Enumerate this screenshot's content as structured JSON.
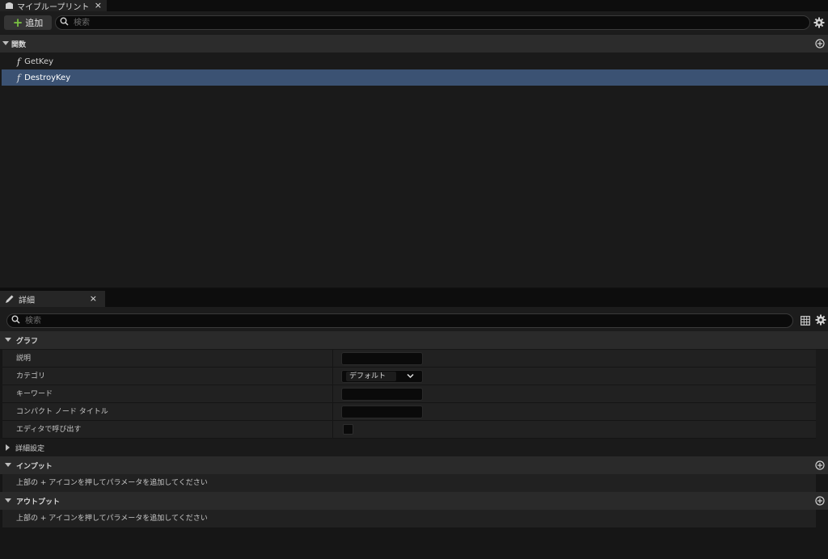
{
  "blueprint": {
    "tab_title": "マイブループリント",
    "tab_close": "×",
    "add_label": "追加",
    "search_placeholder": "検索",
    "functions_header": "関数",
    "functions": [
      {
        "label": "GetKey",
        "selected": false
      },
      {
        "label": "DestroyKey",
        "selected": true
      }
    ],
    "function_glyph": "f"
  },
  "details": {
    "tab_title": "詳細",
    "tab_close": "×",
    "search_placeholder": "検索",
    "graph_header": "グラフ",
    "properties": {
      "description_label": "説明",
      "category_label": "カテゴリ",
      "category_value": "デフォルト",
      "keywords_label": "キーワード",
      "compact_title_label": "コンパクト ノード タイトル",
      "call_in_editor_label": "エディタで呼び出す"
    },
    "advanced_label": "詳細設定",
    "inputs_header": "インプット",
    "inputs_hint": "上部の + アイコンを押してパラメータを追加してください",
    "outputs_header": "アウトプット",
    "outputs_hint": "上部の + アイコンを押してパラメータを追加してください"
  },
  "colors": {
    "accent_add": "#7ac242",
    "selection": "#3b5273"
  }
}
